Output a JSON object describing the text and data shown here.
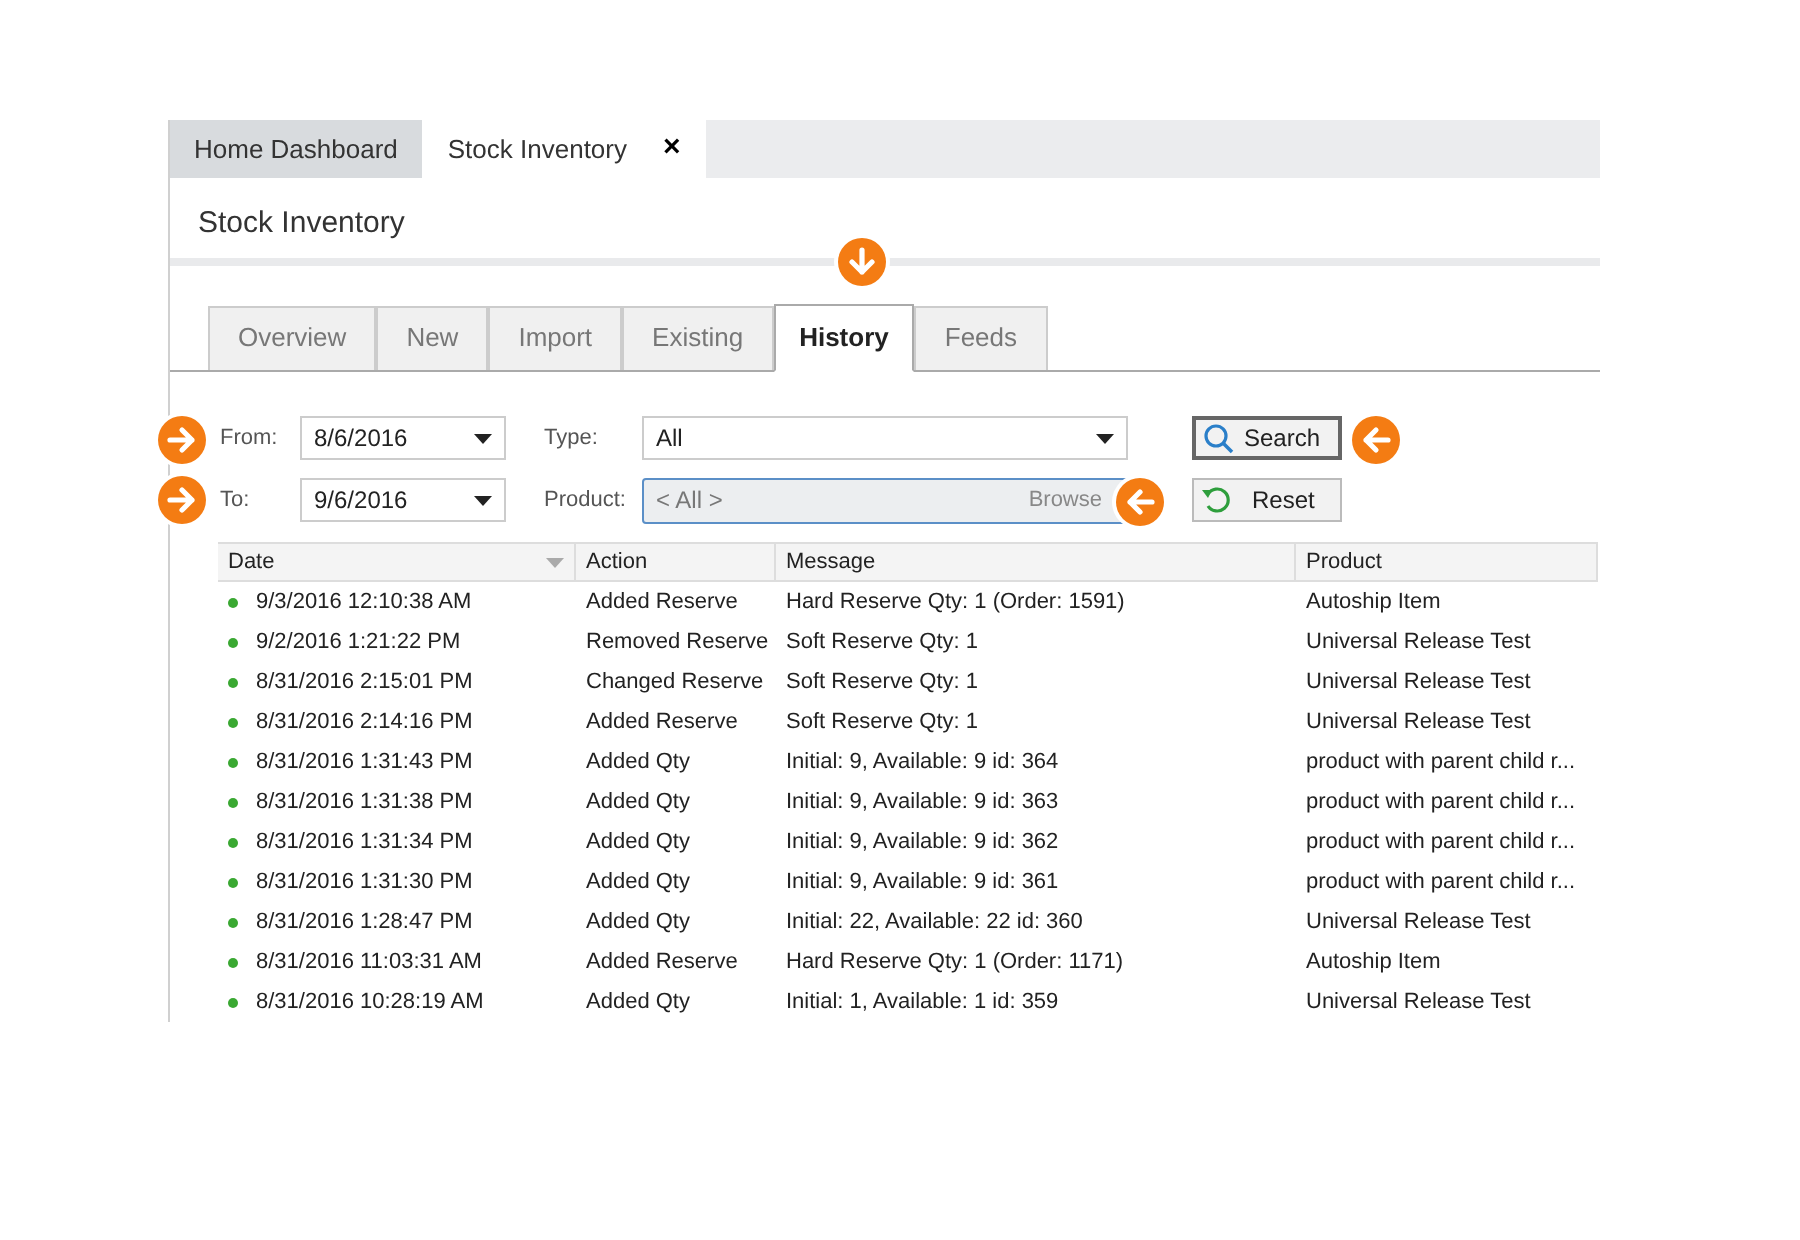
{
  "doc_tabs": [
    {
      "label": "Home Dashboard",
      "selected": false
    },
    {
      "label": "Stock Inventory",
      "selected": true,
      "close": "×"
    }
  ],
  "page_title": "Stock Inventory",
  "tabs": [
    {
      "label": "Overview",
      "selected": false
    },
    {
      "label": "New",
      "selected": false
    },
    {
      "label": "Import",
      "selected": false
    },
    {
      "label": "Existing",
      "selected": false
    },
    {
      "label": "History",
      "selected": true
    },
    {
      "label": "Feeds",
      "selected": false
    }
  ],
  "filters": {
    "from_label": "From:",
    "from_value": "8/6/2016",
    "to_label": "To:",
    "to_value": "9/6/2016",
    "type_label": "Type:",
    "type_value": "All",
    "product_label": "Product:",
    "product_value": "< All >",
    "browse": "Browse",
    "search_button": "Search",
    "reset_button": "Reset"
  },
  "table": {
    "columns": [
      "Date",
      "Action",
      "Message",
      "Product"
    ],
    "rows": [
      [
        "9/3/2016 12:10:38 AM",
        "Added Reserve",
        "Hard Reserve Qty: 1 (Order: 1591)",
        "Autoship Item"
      ],
      [
        "9/2/2016 1:21:22 PM",
        "Removed Reserve",
        "Soft Reserve Qty: 1",
        "Universal Release Test"
      ],
      [
        "8/31/2016 2:15:01 PM",
        "Changed Reserve",
        "Soft Reserve Qty: 1",
        "Universal Release Test"
      ],
      [
        "8/31/2016 2:14:16 PM",
        "Added Reserve",
        "Soft Reserve Qty: 1",
        "Universal Release Test"
      ],
      [
        "8/31/2016 1:31:43 PM",
        "Added Qty",
        "Initial: 9, Available: 9 id: 364",
        "product with parent child r..."
      ],
      [
        "8/31/2016 1:31:38 PM",
        "Added Qty",
        "Initial: 9, Available: 9 id: 363",
        "product with parent child r..."
      ],
      [
        "8/31/2016 1:31:34 PM",
        "Added Qty",
        "Initial: 9, Available: 9 id: 362",
        "product with parent child r..."
      ],
      [
        "8/31/2016 1:31:30 PM",
        "Added Qty",
        "Initial: 9, Available: 9 id: 361",
        "product with parent child r..."
      ],
      [
        "8/31/2016 1:28:47 PM",
        "Added Qty",
        "Initial: 22, Available: 22 id: 360",
        "Universal Release Test"
      ],
      [
        "8/31/2016 11:03:31 AM",
        "Added Reserve",
        "Hard Reserve Qty: 1 (Order: 1171)",
        "Autoship Item"
      ],
      [
        "8/31/2016 10:28:19 AM",
        "Added Qty",
        "Initial: 1, Available: 1 id: 359",
        "Universal Release Test"
      ]
    ]
  }
}
